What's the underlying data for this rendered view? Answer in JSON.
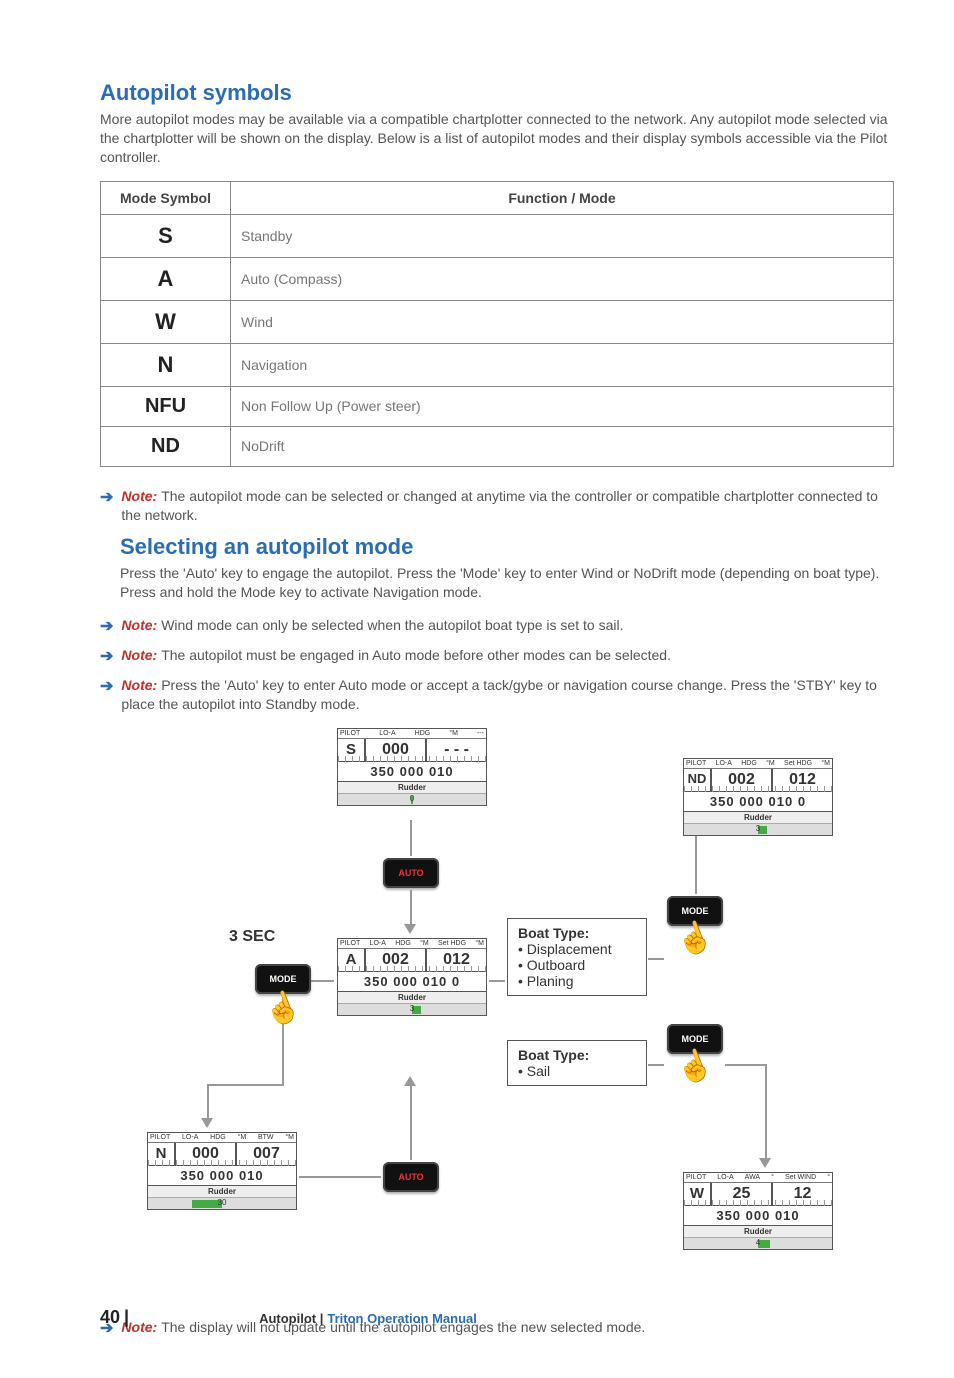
{
  "headings": {
    "h1": "Autopilot symbols",
    "h2": "Selecting an autopilot mode"
  },
  "paragraphs": {
    "intro": "More autopilot modes may be available via a compatible chartplotter connected to the network. Any autopilot mode selected via the chartplotter will be shown on the display. Below is a list of autopilot modes and their display symbols accessible via the Pilot controller.",
    "selecting": "Press the 'Auto' key to engage the autopilot. Press the 'Mode' key to enter Wind or NoDrift mode (depending on boat type). Press and hold the Mode key to activate Navigation mode."
  },
  "table": {
    "col1": "Mode Symbol",
    "col2": "Function / Mode",
    "rows": [
      {
        "sym": "S",
        "func": "Standby"
      },
      {
        "sym": "A",
        "func": "Auto (Compass)"
      },
      {
        "sym": "W",
        "func": "Wind"
      },
      {
        "sym": "N",
        "func": "Navigation"
      },
      {
        "sym": "NFU",
        "func": "Non Follow Up (Power steer)"
      },
      {
        "sym": "ND",
        "func": "NoDrift"
      }
    ]
  },
  "notes": {
    "note_label": "Note:",
    "n1": "The autopilot mode can be selected or changed at anytime via the controller or compatible chartplotter connected to the network.",
    "n2": "Wind mode can only be selected when the autopilot boat type is set to sail.",
    "n3": "The autopilot must be engaged in Auto mode before other modes can be selected.",
    "n4": "Press the 'Auto' key to enter Auto mode or accept a tack/gybe or navigation course change. Press the 'STBY' key to place the autopilot into Standby mode.",
    "n5": "The display will not update until the autopilot engages the new selected mode."
  },
  "diagram": {
    "three_sec": "3 SEC",
    "keys": {
      "auto": "AUTO",
      "mode": "MODE"
    },
    "boat1": {
      "h": "Boat Type:",
      "items": [
        "• Displacement",
        "• Outboard",
        "• Planing"
      ]
    },
    "boat2": {
      "h": "Boat Type:",
      "items": [
        "• Sail"
      ]
    },
    "panel_labels": {
      "pilot": "PILOT",
      "lo": "LO-A",
      "hdg": "HDG",
      "awa": "AWA",
      "deg": "°M",
      "sethdg": "Set HDG",
      "setwind": "Set WIND",
      "btw": "BTW",
      "rudder": "Rudder",
      "dash": "---"
    },
    "panels": {
      "S": {
        "mode": "S",
        "v1": "000",
        "v2": "- - -",
        "scale": "350  000  010",
        "rud": "0"
      },
      "A": {
        "mode": "A",
        "v1": "002",
        "v2": "012",
        "scale": "350  000  010  0",
        "rud": "3"
      },
      "ND": {
        "mode": "ND",
        "v1": "002",
        "v2": "012",
        "scale": "350  000  010  0",
        "rud": "3"
      },
      "N": {
        "mode": "N",
        "v1": "000",
        "v2": "007",
        "scale": "350  000  010",
        "rud": "30"
      },
      "W": {
        "mode": "W",
        "v1": "25",
        "v2": "12",
        "scale": "350  000  010",
        "rud": "4"
      }
    }
  },
  "footer": {
    "page": "40",
    "bar": "|",
    "section": "Autopilot |",
    "doc": "Triton Operation Manual"
  }
}
